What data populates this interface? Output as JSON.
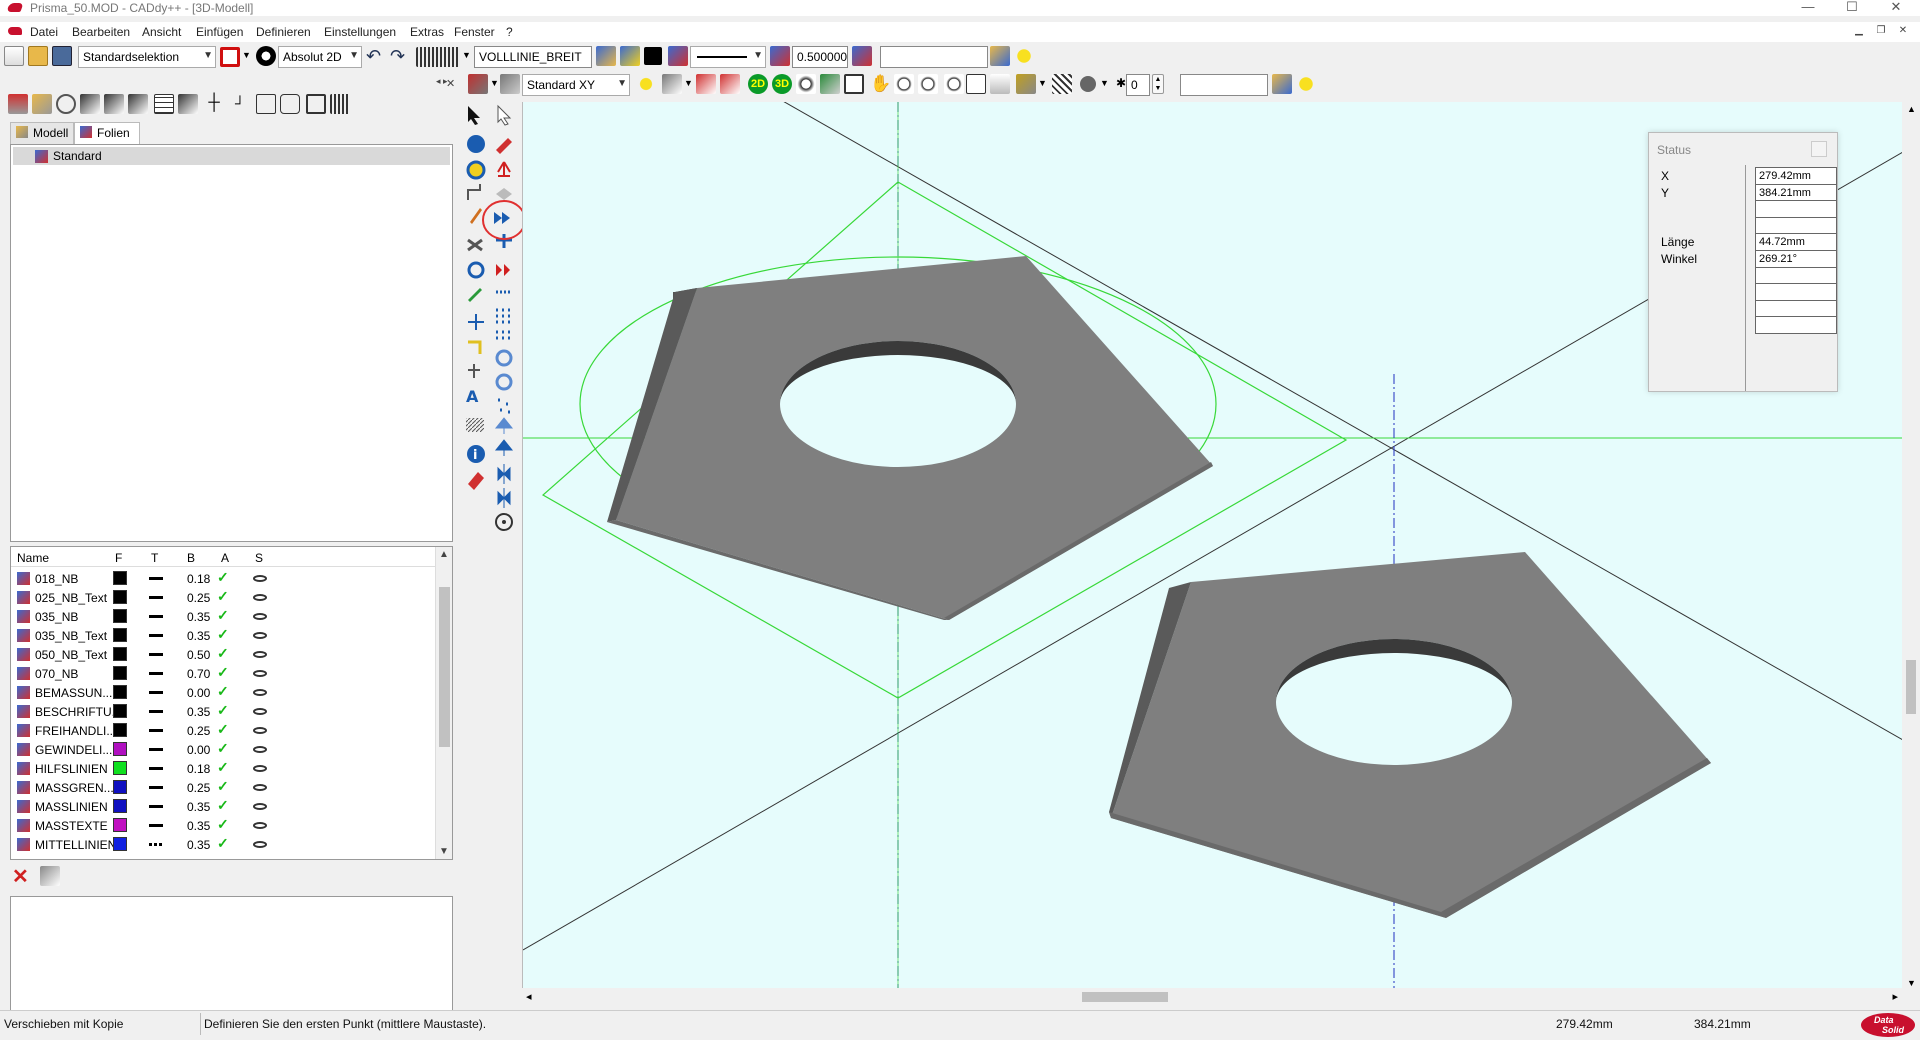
{
  "window": {
    "title": "Prisma_50.MOD  -  CADdy++ - [3D-Modell]",
    "minimize": "—",
    "maximize": "☐",
    "close": "✕"
  },
  "menu": {
    "items": [
      "Datei",
      "Bearbeiten",
      "Ansicht",
      "Einfügen",
      "Definieren",
      "Einstellungen",
      "Extras",
      "Fenster",
      "?"
    ]
  },
  "toolbar1": {
    "selection_mode": "Standardselektion",
    "coord_mode": "Absolut 2D",
    "linetype": "VOLLLINIE_BREIT",
    "line_width": "0.500000",
    "layer_field": ""
  },
  "toolbar2": {
    "view_mode": "Standard XY",
    "btn_2d": "2D",
    "btn_3d": "3D",
    "spin_value": "0",
    "search_field": ""
  },
  "left_panel": {
    "tabs": [
      "Modell",
      "Folien"
    ],
    "active_tab": "Folien",
    "tree_item": "Standard",
    "layer_headers": [
      "Name",
      "F",
      "T",
      "B",
      "A",
      "S"
    ],
    "layers": [
      {
        "name": "018_NB",
        "color": "#000000",
        "width": "0.18",
        "icon": "layer-stack-icon",
        "linestyle": "solid"
      },
      {
        "name": "025_NB_Text",
        "color": "#000000",
        "width": "0.25",
        "icon": "layer-stack-icon",
        "linestyle": "solid"
      },
      {
        "name": "035_NB",
        "color": "#000000",
        "width": "0.35",
        "icon": "layer-stack-icon",
        "linestyle": "solid"
      },
      {
        "name": "035_NB_Text",
        "color": "#000000",
        "width": "0.35",
        "icon": "layer-stack-icon",
        "linestyle": "solid"
      },
      {
        "name": "050_NB_Text",
        "color": "#000000",
        "width": "0.50",
        "icon": "layer-stack-icon",
        "linestyle": "solid"
      },
      {
        "name": "070_NB",
        "color": "#000000",
        "width": "0.70",
        "icon": "layer-stack-icon",
        "linestyle": "solid"
      },
      {
        "name": "BEMASSUN...",
        "color": "#000000",
        "width": "0.00",
        "icon": "dimension-icon",
        "linestyle": "solid"
      },
      {
        "name": "BESCHRIFTU...",
        "color": "#000000",
        "width": "0.35",
        "icon": "text-edit-icon",
        "linestyle": "solid"
      },
      {
        "name": "FREIHANDLI...",
        "color": "#000000",
        "width": "0.25",
        "icon": "layer-stack-icon",
        "linestyle": "solid"
      },
      {
        "name": "GEWINDELI...",
        "color": "#b010c0",
        "width": "0.00",
        "icon": "thread-icon",
        "linestyle": "solid"
      },
      {
        "name": "HILFSLINIEN",
        "color": "#10e020",
        "width": "0.18",
        "icon": "construction-line-icon",
        "linestyle": "solid"
      },
      {
        "name": "MASSGREN...",
        "color": "#1010c0",
        "width": "0.25",
        "icon": "dimension-limit-icon",
        "linestyle": "solid"
      },
      {
        "name": "MASSLINIEN",
        "color": "#1010c0",
        "width": "0.35",
        "icon": "dimension-line-icon",
        "linestyle": "solid"
      },
      {
        "name": "MASSTEXTE",
        "color": "#c010c0",
        "width": "0.35",
        "icon": "dimension-text-icon",
        "linestyle": "solid"
      },
      {
        "name": "MITTELLINIEN",
        "color": "#1020e0",
        "width": "0.35",
        "icon": "centerline-icon",
        "linestyle": "dashdot"
      }
    ]
  },
  "status_window": {
    "title": "Status",
    "rows": [
      {
        "label": "X",
        "value": "279.42mm"
      },
      {
        "label": "Y",
        "value": "384.21mm"
      },
      {
        "label": "",
        "value": ""
      },
      {
        "label": "",
        "value": ""
      },
      {
        "label": "Länge",
        "value": "44.72mm"
      },
      {
        "label": "Winkel",
        "value": "269.21°"
      },
      {
        "label": "",
        "value": ""
      },
      {
        "label": "",
        "value": ""
      },
      {
        "label": "",
        "value": ""
      },
      {
        "label": "",
        "value": ""
      }
    ]
  },
  "statusbar": {
    "command": "Verschieben mit Kopie",
    "prompt": "Definieren Sie den ersten Punkt (mittlere Maustaste).",
    "x": "279.42mm",
    "y": "384.21mm",
    "logo_line1": "Data",
    "logo_line2": "Solid"
  },
  "colors": {
    "viewport_bg": "#e6fcfc",
    "solid_face": "#8a8a8a",
    "construction": "#38d838",
    "centerline": "#2030c0",
    "highlight_circle": "#e03030",
    "brand_red": "#c8102e"
  }
}
